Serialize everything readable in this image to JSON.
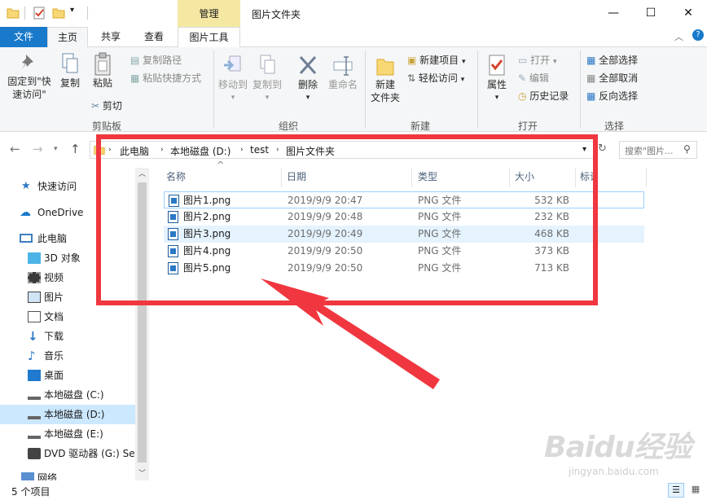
{
  "window": {
    "manage_tab": "管理",
    "title": "图片文件夹",
    "minimize": "—",
    "maximize": "☐",
    "close": "✕"
  },
  "tabs": {
    "file": "文件",
    "home": "主页",
    "share": "共享",
    "view": "查看",
    "picture_tools": "图片工具"
  },
  "ribbon": {
    "pin_quick_access": "固定到\"快",
    "pin_quick_access_2": "速访问\"",
    "copy": "复制",
    "paste": "粘贴",
    "copy_path": "复制路径",
    "paste_shortcut": "粘贴快捷方式",
    "cut": "剪切",
    "clipboard_group": "剪贴板",
    "move_to": "移动到",
    "copy_to": "复制到",
    "delete": "删除",
    "rename": "重命名",
    "organize_group": "组织",
    "new_folder": "新建",
    "new_folder_2": "文件夹",
    "new_item": "新建项目",
    "easy_access": "轻松访问",
    "new_group": "新建",
    "properties": "属性",
    "open": "打开",
    "edit": "编辑",
    "history": "历史记录",
    "open_group": "打开",
    "select_all": "全部选择",
    "select_none": "全部取消",
    "invert_selection": "反向选择",
    "select_group": "选择"
  },
  "address": {
    "crumbs": [
      "此电脑",
      "本地磁盘 (D:)",
      "test",
      "图片文件夹"
    ],
    "search_placeholder": "搜索\"图片..."
  },
  "nav": {
    "quick_access": "快速访问",
    "onedrive": "OneDrive",
    "this_pc": "此电脑",
    "objects_3d": "3D 对象",
    "videos": "视频",
    "pictures": "图片",
    "documents": "文档",
    "downloads": "下载",
    "music": "音乐",
    "desktop": "桌面",
    "disk_c": "本地磁盘 (C:)",
    "disk_d": "本地磁盘 (D:)",
    "disk_e": "本地磁盘 (E:)",
    "dvd": "DVD 驱动器 (G:) Set",
    "network": "网络"
  },
  "columns": {
    "name": "名称",
    "date": "日期",
    "type": "类型",
    "size": "大小",
    "tags": "标记"
  },
  "files": [
    {
      "name": "图片1.png",
      "date": "2019/9/9 20:47",
      "type": "PNG 文件",
      "size": "532 KB"
    },
    {
      "name": "图片2.png",
      "date": "2019/9/9 20:48",
      "type": "PNG 文件",
      "size": "232 KB"
    },
    {
      "name": "图片3.png",
      "date": "2019/9/9 20:49",
      "type": "PNG 文件",
      "size": "468 KB"
    },
    {
      "name": "图片4.png",
      "date": "2019/9/9 20:50",
      "type": "PNG 文件",
      "size": "373 KB"
    },
    {
      "name": "图片5.png",
      "date": "2019/9/9 20:50",
      "type": "PNG 文件",
      "size": "713 KB"
    }
  ],
  "status": {
    "item_count": "5 个项目"
  },
  "watermark": {
    "logo": "Baidu经验",
    "url": "jingyan.baidu.com"
  },
  "colors": {
    "accent": "#1979ca",
    "selection": "#cce8ff",
    "annotation": "#f0373f",
    "manage_tab": "#f4e8a3"
  }
}
